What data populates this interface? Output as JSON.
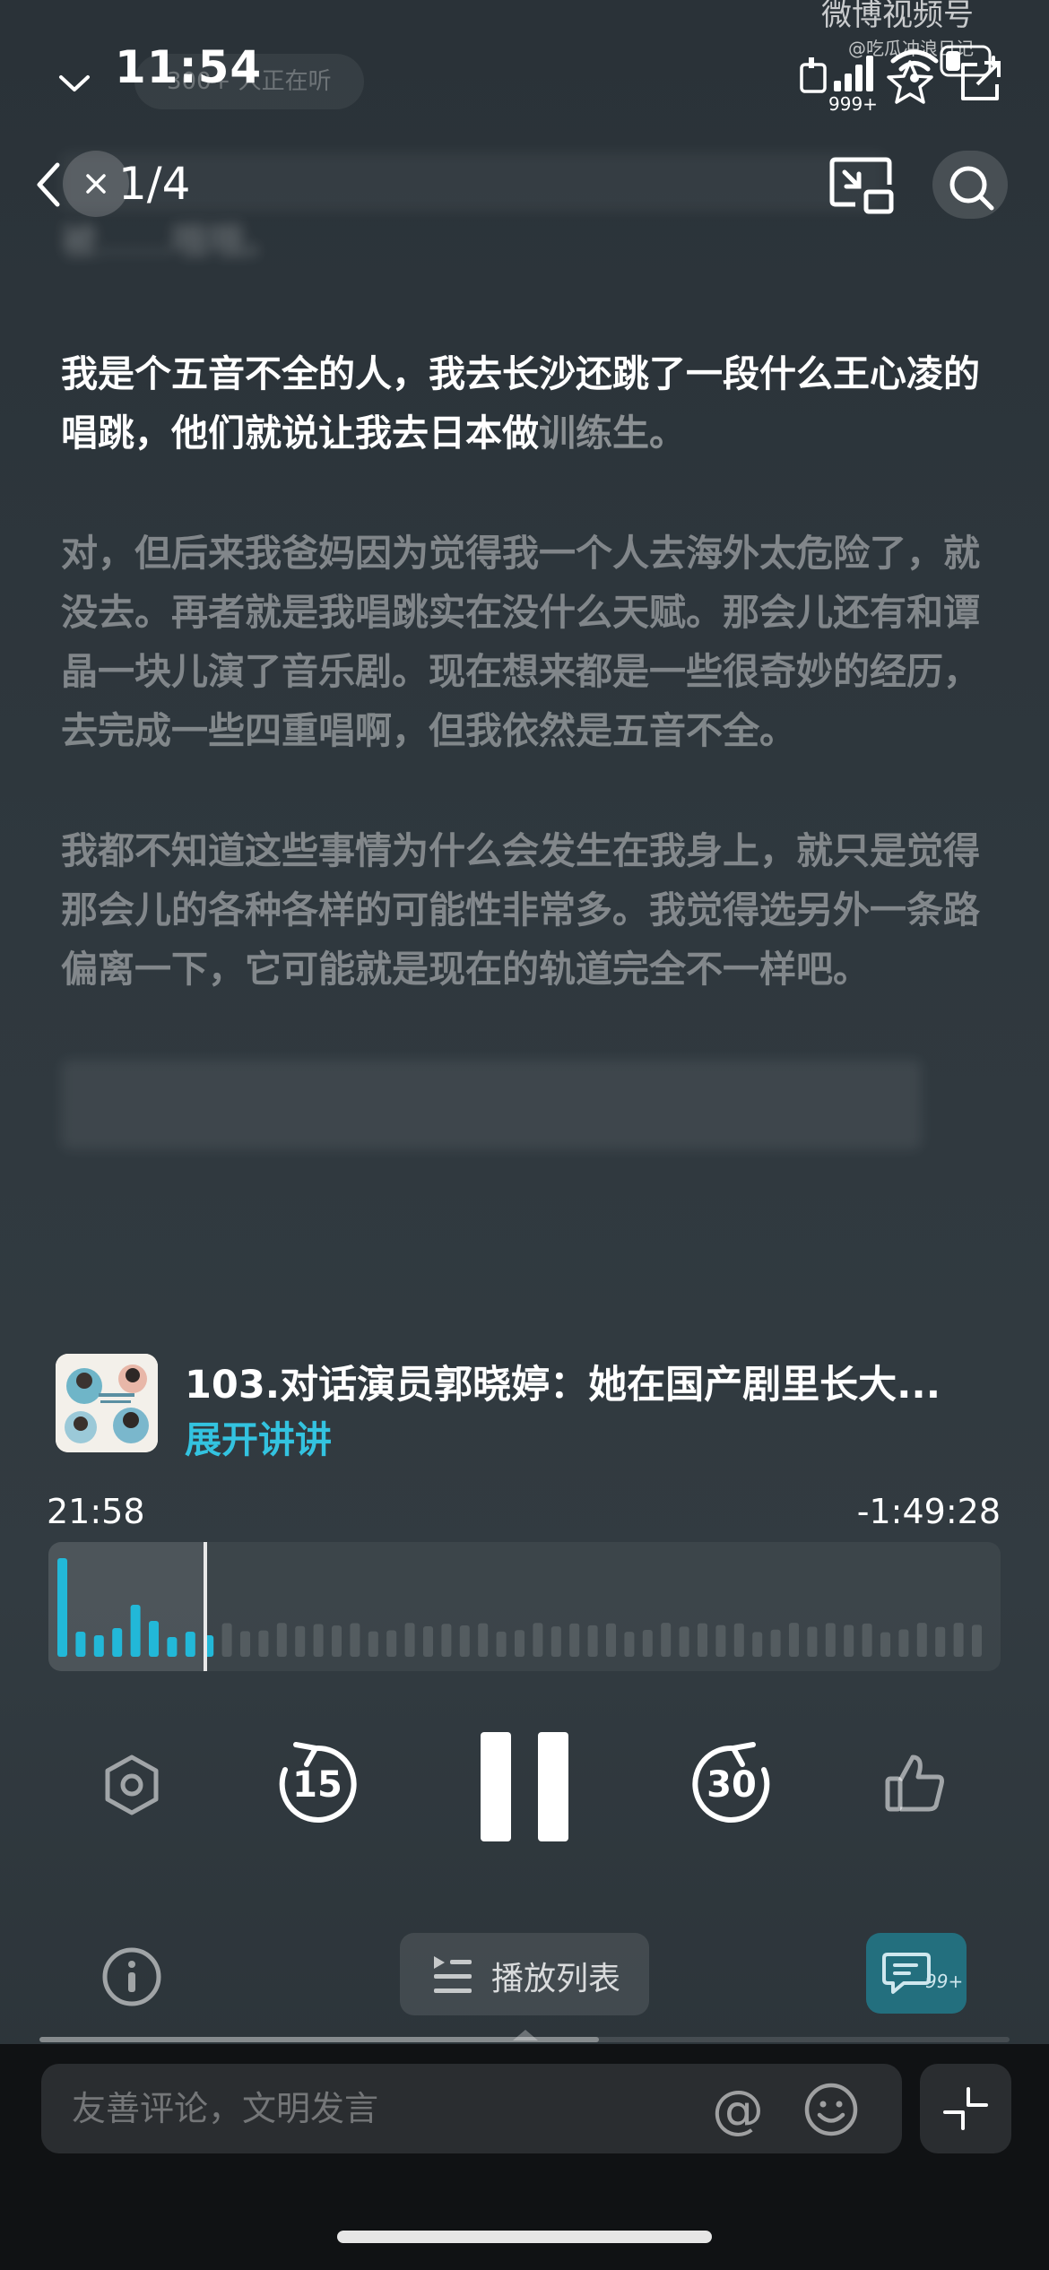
{
  "status_bar": {
    "time": "11:54",
    "listeners": "300+ 人正在听",
    "notification_count": "999+"
  },
  "watermark": {
    "title": "微博视频号",
    "handle": "@吃瓜冲浪日记"
  },
  "nav": {
    "page_indicator": "1/4"
  },
  "transcript": {
    "blurred_top": "被……哦哦。",
    "current_main": "我是个五音不全的人，我去长沙还跳了一段什么王心凌的唱跳，他们就说让我去日本做",
    "current_tail": "训练生。",
    "paragraph_2": "对，但后来我爸妈因为觉得我一个人去海外太危险了，就没去。再者就是我唱跳实在没什么天赋。那会儿还有和谭晶一块儿演了音乐剧。现在想来都是一些很奇妙的经历，去完成一些四重唱啊，但我依然是五音不全。",
    "paragraph_3": "我都不知道这些事情为什么会发生在我身上，就只是觉得那会儿的各种各样的可能性非常多。我觉得选另外一条路偏离一下，它可能就是现在的轨道完全不一样吧。"
  },
  "episode": {
    "title": "103.对话演员郭晓婷：她在国产剧里长大...",
    "action_label": "展开讲讲"
  },
  "player": {
    "elapsed": "21:58",
    "remaining": "-1:49:28",
    "progress": 0.165,
    "skip_back_seconds": "15",
    "skip_forward_seconds": "30",
    "accent_color": "#22b8d8"
  },
  "bottom": {
    "playlist_label": "播放列表",
    "comment_badge": "99+"
  },
  "comment": {
    "placeholder": "友善评论，文明发言",
    "mention_symbol": "@"
  }
}
